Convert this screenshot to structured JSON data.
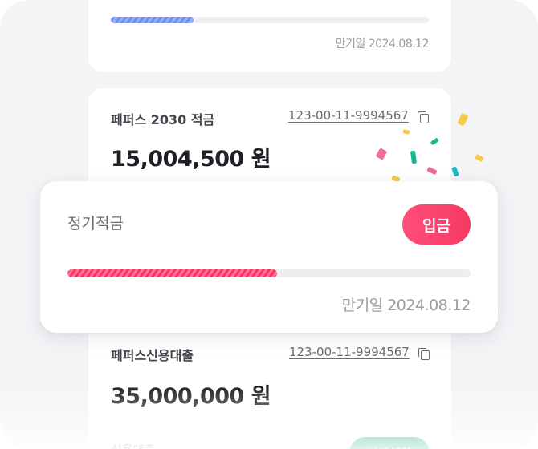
{
  "card_top": {
    "progress": 0.26,
    "maturity": "만기일 2024.08.12"
  },
  "card_mid": {
    "account_name": "페퍼스 2030 적금",
    "account_number": "123-00-11-9994567",
    "amount": "15,004,500 원"
  },
  "popup": {
    "title": "정기적금",
    "deposit_label": "입금",
    "progress": 0.52,
    "maturity": "만기일 2024.08.12"
  },
  "card_bot": {
    "account_name": "페퍼스신용대출",
    "account_number": "123-00-11-9994567",
    "amount": "35,000,000 원",
    "loan_type": "신용대출",
    "button_label": "이자상환"
  },
  "colors": {
    "panel_bg": "#f4f4f7",
    "accent_pink": "#ff3d6a",
    "accent_blue": "#6f8ef0",
    "accent_green": "#1db38a"
  },
  "icons": [
    "copy-icon",
    "confetti"
  ]
}
